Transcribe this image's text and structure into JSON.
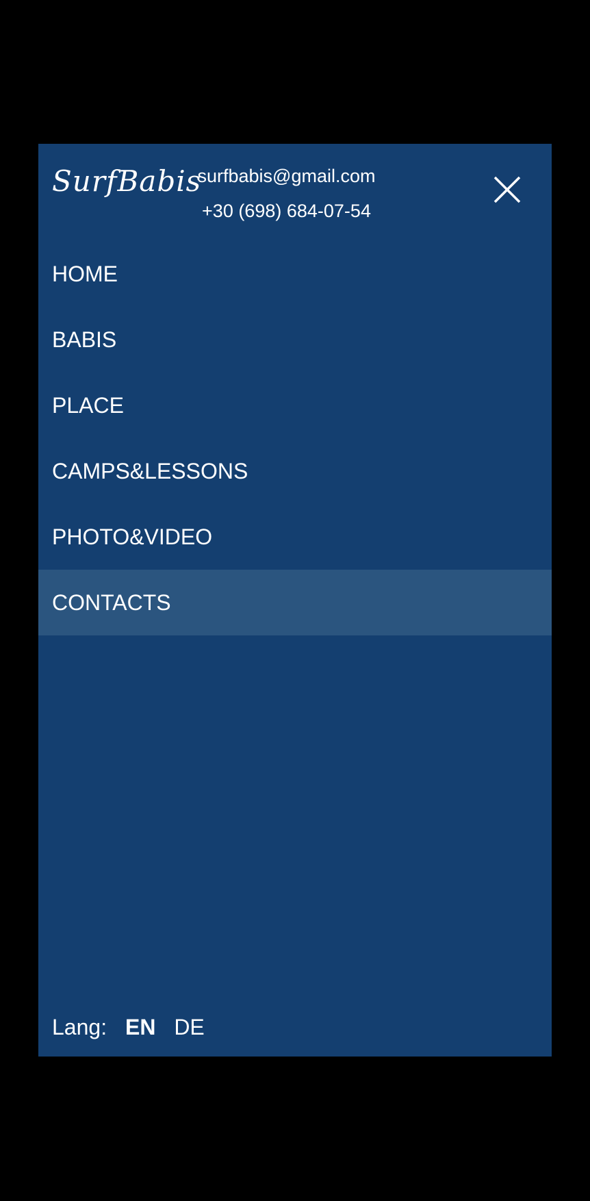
{
  "header": {
    "logo_text": "SurfBabis",
    "email": "surfbabis@gmail.com",
    "phone": "+30 (698) 684-07-54",
    "close_icon": "close-icon"
  },
  "nav": {
    "items": [
      {
        "label": "HOME",
        "active": false
      },
      {
        "label": "BABIS",
        "active": false
      },
      {
        "label": "PLACE",
        "active": false
      },
      {
        "label": "CAMPS&LESSONS",
        "active": false
      },
      {
        "label": "PHOTO&VIDEO",
        "active": false
      },
      {
        "label": "CONTACTS",
        "active": true
      }
    ]
  },
  "lang": {
    "label": "Lang:",
    "options": [
      {
        "code": "EN",
        "current": true
      },
      {
        "code": "DE",
        "current": false
      }
    ]
  },
  "colors": {
    "page_background": "#000000",
    "panel_background": "#143f70",
    "active_item_background": "#2b557f",
    "text": "#ffffff"
  }
}
